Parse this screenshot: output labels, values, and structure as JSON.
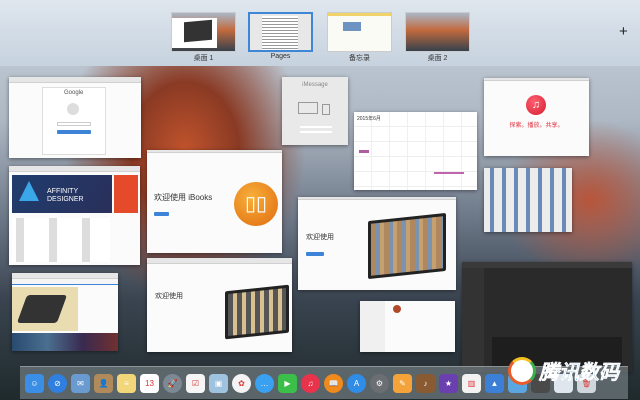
{
  "spaces": [
    {
      "label": "桌面 1",
      "selected": false
    },
    {
      "label": "Pages",
      "selected": true
    },
    {
      "label": "备忘录",
      "selected": false
    },
    {
      "label": "桌面 2",
      "selected": false
    }
  ],
  "add_space_label": "+",
  "windows": {
    "google": {
      "logo": "Google"
    },
    "imessage": {
      "title": "iMessage"
    },
    "calendar": {
      "title": "2015年6月"
    },
    "itunes": {
      "tagline": "探索。播放。共享。"
    },
    "appstore": {
      "banner": "AFFINITY DESIGNER"
    },
    "ibooks": {
      "title": "欢迎使用 iBooks"
    },
    "photos": {
      "title": "欢迎使用"
    },
    "ibookstore": {
      "title": "欢迎使用"
    }
  },
  "dock": {
    "items": [
      {
        "name": "finder",
        "color": "#3a8ee6",
        "glyph": "☺"
      },
      {
        "name": "safari",
        "color": "#2f7fe0",
        "glyph": "⊘"
      },
      {
        "name": "mail",
        "color": "#6a9bd0",
        "glyph": "✉"
      },
      {
        "name": "contacts",
        "color": "#b08a5a",
        "glyph": "👤"
      },
      {
        "name": "notes",
        "color": "#f1d67a",
        "glyph": "≡"
      },
      {
        "name": "calendar",
        "color": "#ffffff",
        "glyph": "13"
      },
      {
        "name": "launchpad",
        "color": "#7c8894",
        "glyph": "🚀"
      },
      {
        "name": "reminders",
        "color": "#f5f5f5",
        "glyph": "☑"
      },
      {
        "name": "preview",
        "color": "#9fc2de",
        "glyph": "▣"
      },
      {
        "name": "photos",
        "color": "#f4f4f4",
        "glyph": "✿"
      },
      {
        "name": "messages",
        "color": "#3aa0f0",
        "glyph": "…"
      },
      {
        "name": "facetime",
        "color": "#3bbf4a",
        "glyph": "▶"
      },
      {
        "name": "itunes",
        "color": "#e8334a",
        "glyph": "♫"
      },
      {
        "name": "ibooks",
        "color": "#f08a1c",
        "glyph": "📖"
      },
      {
        "name": "app-store",
        "color": "#2f8de8",
        "glyph": "A"
      },
      {
        "name": "system-preferences",
        "color": "#6b6f74",
        "glyph": "⚙"
      },
      {
        "name": "pages",
        "color": "#f3a33a",
        "glyph": "✎"
      },
      {
        "name": "garageband",
        "color": "#8a5a32",
        "glyph": "♪"
      },
      {
        "name": "imovie",
        "color": "#6a3fb0",
        "glyph": "★"
      },
      {
        "name": "numbers",
        "color": "#f2f2f2",
        "glyph": "▥"
      },
      {
        "name": "keynote",
        "color": "#3b7fd6",
        "glyph": "▲"
      },
      {
        "name": "folder",
        "color": "#5aa6e0",
        "glyph": ""
      },
      {
        "name": "downloads",
        "color": "#4a4a4a",
        "glyph": ""
      },
      {
        "name": "documents",
        "color": "#dfe6ee",
        "glyph": ""
      },
      {
        "name": "trash",
        "color": "#cfd6dc",
        "glyph": "🗑"
      }
    ]
  },
  "watermark": "腾讯数码"
}
